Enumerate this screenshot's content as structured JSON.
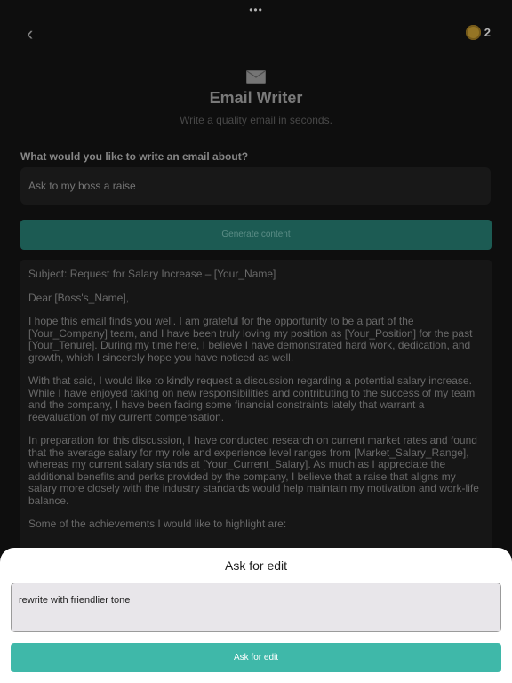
{
  "top_bar": {
    "more_glyph": "•••",
    "back_glyph": "‹",
    "coin_count": "2",
    "coin_color": "#b08a2c"
  },
  "header": {
    "title": "Email Writer",
    "subtitle": "Write a quality email in seconds."
  },
  "form": {
    "question": "What would you like to write an email about?",
    "prompt_value": "Ask to my boss a raise",
    "generate_label": "Generate content"
  },
  "email": {
    "paragraphs": [
      "Subject: Request for Salary Increase – [Your_Name]",
      "Dear [Boss's_Name],",
      "I hope this email finds you well. I am grateful for the opportunity to be a part of the [Your_Company] team, and I have been truly loving my position as [Your_Position] for the past [Your_Tenure]. During my time here, I believe I have demonstrated hard work, dedication, and growth, which I sincerely hope you have noticed as well.",
      "With that said, I would like to kindly request a discussion regarding a potential salary increase. While I have enjoyed taking on new responsibilities and contributing to the success of my team and the company, I have been facing some financial constraints lately that warrant a reevaluation of my current compensation.",
      "In preparation for this discussion, I have conducted research on current market rates and found that the average salary for my role and experience level ranges from [Market_Salary_Range], whereas my current salary stands at [Your_Current_Salary]. As much as I appreciate the additional benefits and perks provided by the company, I believe that a raise that aligns my salary more closely with the industry standards would help maintain my motivation and work-life balance.",
      "Some of the achievements I would like to highlight are:"
    ]
  },
  "sheet": {
    "title": "Ask for edit",
    "edit_value": "rewrite with friendlier tone",
    "button_label": "Ask for edit",
    "accent": "#3fb8a9"
  }
}
